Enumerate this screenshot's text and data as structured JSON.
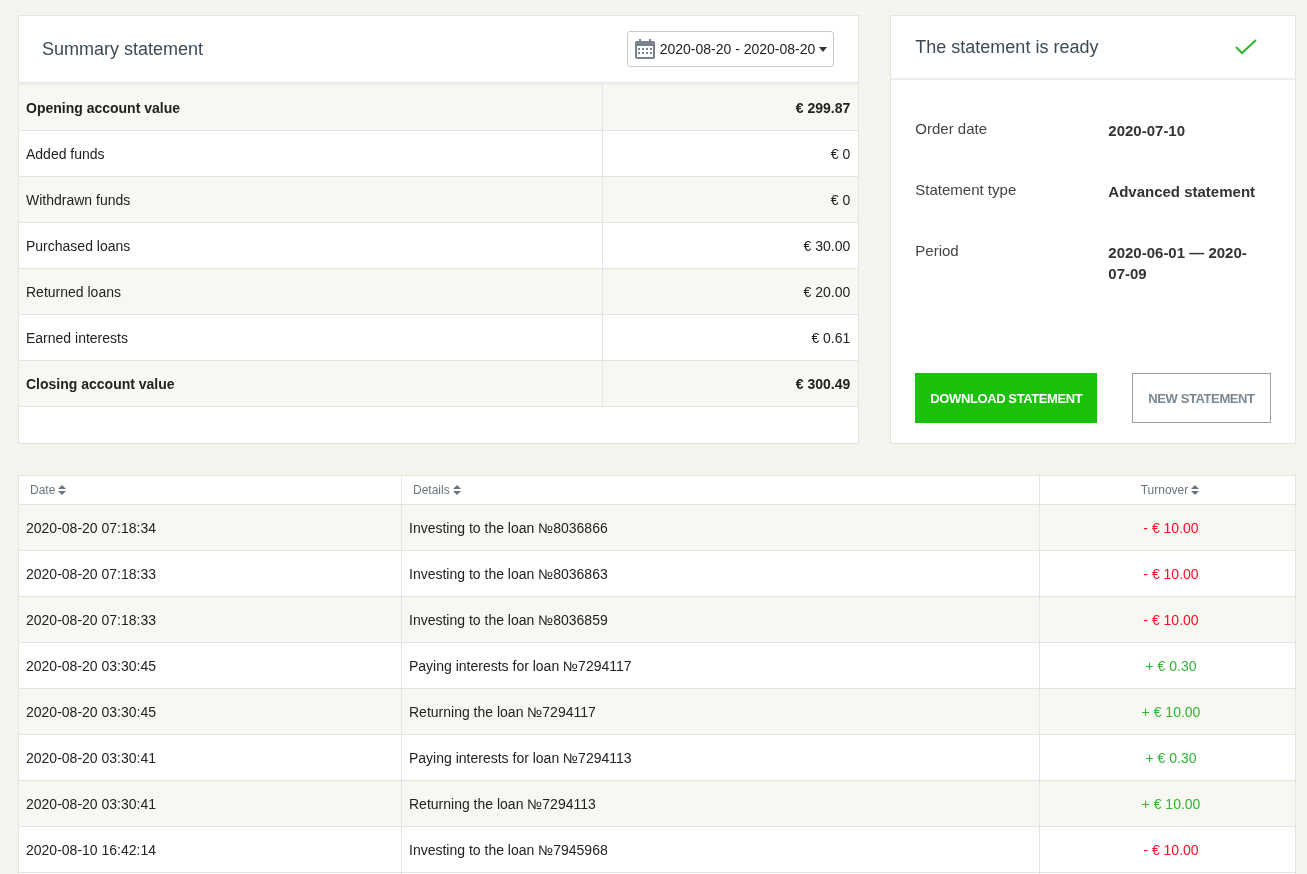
{
  "summary": {
    "title": "Summary statement",
    "date_range": "2020-08-20 - 2020-08-20",
    "rows": [
      {
        "label": "Opening account value",
        "value": "€ 299.87",
        "kind": "total"
      },
      {
        "label": "Added funds",
        "value": "€ 0",
        "kind": "item"
      },
      {
        "label": "Withdrawn funds",
        "value": "€ 0",
        "kind": "item"
      },
      {
        "label": "Purchased loans",
        "value": "€ 30.00",
        "kind": "item"
      },
      {
        "label": "Returned loans",
        "value": "€ 20.00",
        "kind": "item"
      },
      {
        "label": "Earned interests",
        "value": "€ 0.61",
        "kind": "item"
      },
      {
        "label": "Closing account value",
        "value": "€ 300.49",
        "kind": "total"
      }
    ]
  },
  "status": {
    "title": "The statement is ready",
    "ready": true,
    "fields": [
      {
        "label": "Order date",
        "value": "2020-07-10"
      },
      {
        "label": "Statement type",
        "value": "Advanced statement"
      },
      {
        "label": "Period",
        "value": "2020-06-01 — 2020-07-09"
      }
    ],
    "buttons": [
      {
        "label": "DOWNLOAD STATEMENT",
        "kind": "primary"
      },
      {
        "label": "NEW STATEMENT",
        "kind": "secondary"
      }
    ]
  },
  "transactions": {
    "columns": [
      "Date",
      "Details",
      "Turnover"
    ],
    "rows": [
      {
        "date": "2020-08-20 07:18:34",
        "details": "Investing to the loan №8036866",
        "turnover": "- € 10.00",
        "kind": "debit"
      },
      {
        "date": "2020-08-20 07:18:33",
        "details": "Investing to the loan №8036863",
        "turnover": "- € 10.00",
        "kind": "debit"
      },
      {
        "date": "2020-08-20 07:18:33",
        "details": "Investing to the loan №8036859",
        "turnover": "- € 10.00",
        "kind": "debit"
      },
      {
        "date": "2020-08-20 03:30:45",
        "details": "Paying interests for loan №7294117",
        "turnover": "+ € 0.30",
        "kind": "credit"
      },
      {
        "date": "2020-08-20 03:30:45",
        "details": "Returning the loan №7294117",
        "turnover": "+ € 10.00",
        "kind": "credit"
      },
      {
        "date": "2020-08-20 03:30:41",
        "details": "Paying interests for loan №7294113",
        "turnover": "+ € 0.30",
        "kind": "credit"
      },
      {
        "date": "2020-08-20 03:30:41",
        "details": "Returning the loan №7294113",
        "turnover": "+ € 10.00",
        "kind": "credit"
      },
      {
        "date": "2020-08-10 16:42:14",
        "details": "Investing to the loan №7945968",
        "turnover": "- € 10.00",
        "kind": "debit"
      }
    ]
  }
}
